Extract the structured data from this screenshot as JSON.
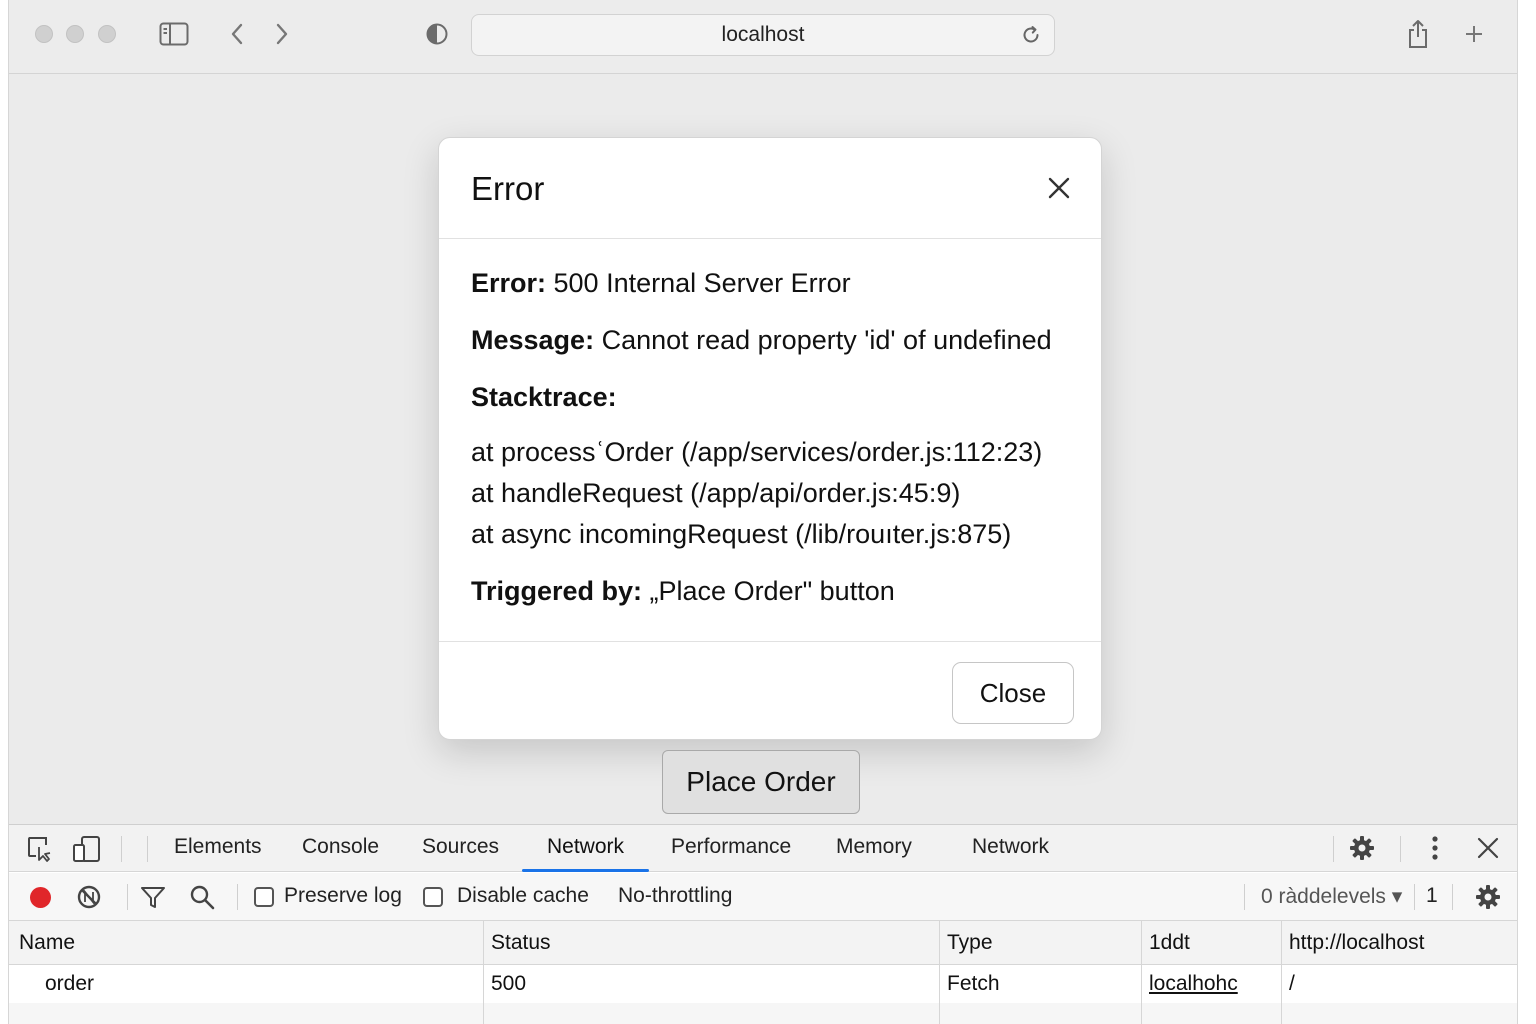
{
  "browser": {
    "url": "localhost"
  },
  "modal": {
    "title": "Error",
    "error_label": "Error:",
    "error_value": " 500 Internal Server Error",
    "message_label": "Message:",
    "message_value": " Cannot read property 'id' of undefined",
    "stacktrace_label": "Stacktrace:",
    "stack": [
      "at processʿOrder  (/app/services/order.js:112:23)",
      "at handleRequest (/app/api/order.js:45:9)",
      "at async incomingRequest (/lib/rouıter.js:875)"
    ],
    "triggered_label": "Triggered by:",
    "triggered_value": " „Place Order\" button",
    "close_label": "Close"
  },
  "page": {
    "place_order_label": "Place Order"
  },
  "devtools": {
    "tabs": [
      "Elements",
      "Console",
      "Sources",
      "Network",
      "Performance",
      "Memory",
      "Network"
    ],
    "active_tab": "Network",
    "filter": {
      "preserve_log": "Preserve log",
      "disable_cache": "Disable cache",
      "throttling": "No-throttling",
      "levels": "0 ràddelevels ▾",
      "count": "1"
    },
    "table": {
      "headers": [
        "Name",
        "Status",
        "Type",
        "1ddt",
        "http://localhost"
      ],
      "rows": [
        [
          "order",
          "500",
          "Fetch",
          "localhohc",
          "/"
        ]
      ]
    }
  },
  "colors": {
    "record": "#e0262a",
    "active_tab_underline": "#1a73e8"
  }
}
